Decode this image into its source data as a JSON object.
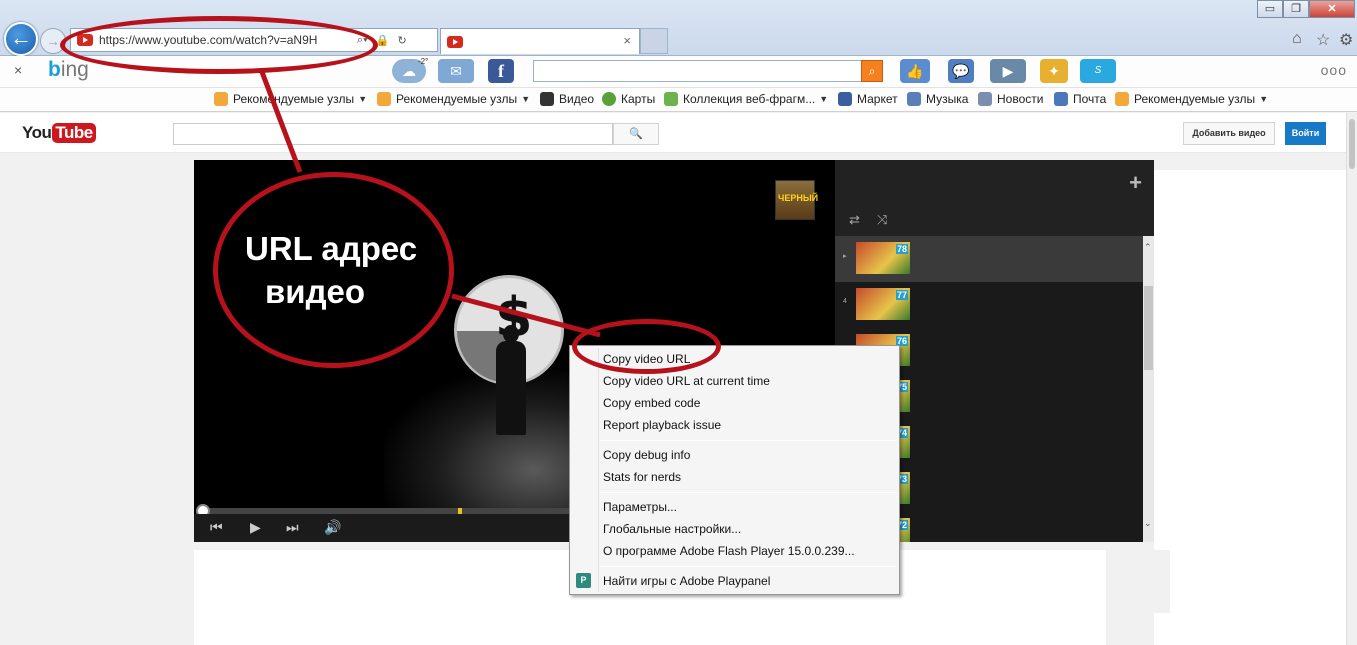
{
  "browser": {
    "address_url": "https://www.youtube.com/watch?v=aN9H",
    "tab_close": "×",
    "window_buttons": [
      "▭",
      "❐",
      "✕"
    ]
  },
  "bing_bar": {
    "close": "×",
    "logo_b": "b",
    "logo_rest": "ing",
    "weather_temp": "-2°",
    "more": "ooo"
  },
  "favorites": [
    {
      "label": "Рекомендуемые узлы",
      "icon": "bing-fav-icon",
      "dropdown": true
    },
    {
      "label": "Рекомендуемые узлы",
      "icon": "bing-fav-icon",
      "dropdown": true
    },
    {
      "label": "Видео",
      "icon": "video-icon",
      "dropdown": false
    },
    {
      "label": "Карты",
      "icon": "maps-icon",
      "dropdown": false
    },
    {
      "label": "Коллекция веб-фрагм...",
      "icon": "webslice-icon",
      "dropdown": true
    },
    {
      "label": "Маркет",
      "icon": "market-icon",
      "dropdown": false
    },
    {
      "label": "Музыка",
      "icon": "music-icon",
      "dropdown": false
    },
    {
      "label": "Новости",
      "icon": "news-icon",
      "dropdown": false
    },
    {
      "label": "Почта",
      "icon": "mail-icon",
      "dropdown": false
    },
    {
      "label": "Рекомендуемые узлы",
      "icon": "bing-fav-icon",
      "dropdown": true
    }
  ],
  "youtube": {
    "logo_you": "You",
    "logo_tube": "Tube",
    "search_button": "🔍",
    "upload_label": "Добавить видео",
    "signin_label": "Войти"
  },
  "player": {
    "channel_badge": "ЧЕРНЫЙ"
  },
  "playlist": {
    "items": [
      {
        "index": "▸",
        "badge": "78",
        "active": true
      },
      {
        "index": "4",
        "badge": "77",
        "active": false
      },
      {
        "index": "",
        "badge": "76",
        "active": false
      },
      {
        "index": "",
        "badge": "75",
        "active": false
      },
      {
        "index": "",
        "badge": "74",
        "active": false
      },
      {
        "index": "",
        "badge": "73",
        "active": false
      },
      {
        "index": "",
        "badge": "72",
        "active": false
      }
    ]
  },
  "context_menu": {
    "items": [
      "Copy video URL",
      "Copy video URL at current time",
      "Copy embed code",
      "Report playback issue",
      "Copy debug info",
      "Stats for nerds",
      "Параметры...",
      "Глобальные настройки...",
      "О программе Adobe Flash Player 15.0.0.239...",
      "Найти игры с Adobe Playpanel"
    ]
  },
  "annotation": {
    "line1": "URL адрес",
    "line2": "видео"
  },
  "colors": {
    "annotation_red": "#b7121c",
    "youtube_red": "#cc181e",
    "youtube_blue": "#167ac6"
  }
}
